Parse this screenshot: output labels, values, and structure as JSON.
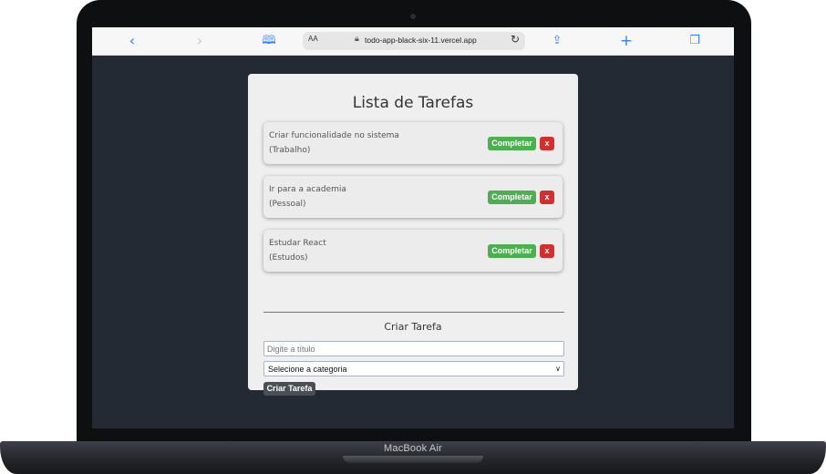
{
  "device": {
    "label": "MacBook Air"
  },
  "browser": {
    "text_size_label": "AA",
    "url": "todo-app-black-six-11.vercel.app",
    "icons": {
      "back": "chevron-left-icon",
      "forward": "chevron-right-icon",
      "bookmarks": "book-icon",
      "lock": "lock-icon",
      "reload": "reload-icon",
      "share": "share-icon",
      "new_tab": "plus-icon",
      "tabs": "tabs-icon"
    }
  },
  "app": {
    "title": "Lista de Tarefas",
    "tasks": [
      {
        "title": "Criar funcionalidade no sistema",
        "category": "(Trabalho)",
        "complete_label": "Completar",
        "delete_label": "x"
      },
      {
        "title": "Ir para a academia",
        "category": "(Pessoal)",
        "complete_label": "Completar",
        "delete_label": "x"
      },
      {
        "title": "Estudar React",
        "category": "(Estudos)",
        "complete_label": "Completar",
        "delete_label": "x"
      }
    ],
    "form": {
      "title": "Criar Tarefa",
      "title_placeholder": "Digite a título",
      "category_selected": "Selecione a categoria",
      "submit_label": "Criar Tarefa"
    }
  },
  "colors": {
    "screen_background": "#232a34",
    "card_background": "#efefef",
    "complete_button": "#4caf50",
    "delete_button": "#d32f2f",
    "create_button": "#4a4f56",
    "browser_accent": "#3b82f6"
  }
}
